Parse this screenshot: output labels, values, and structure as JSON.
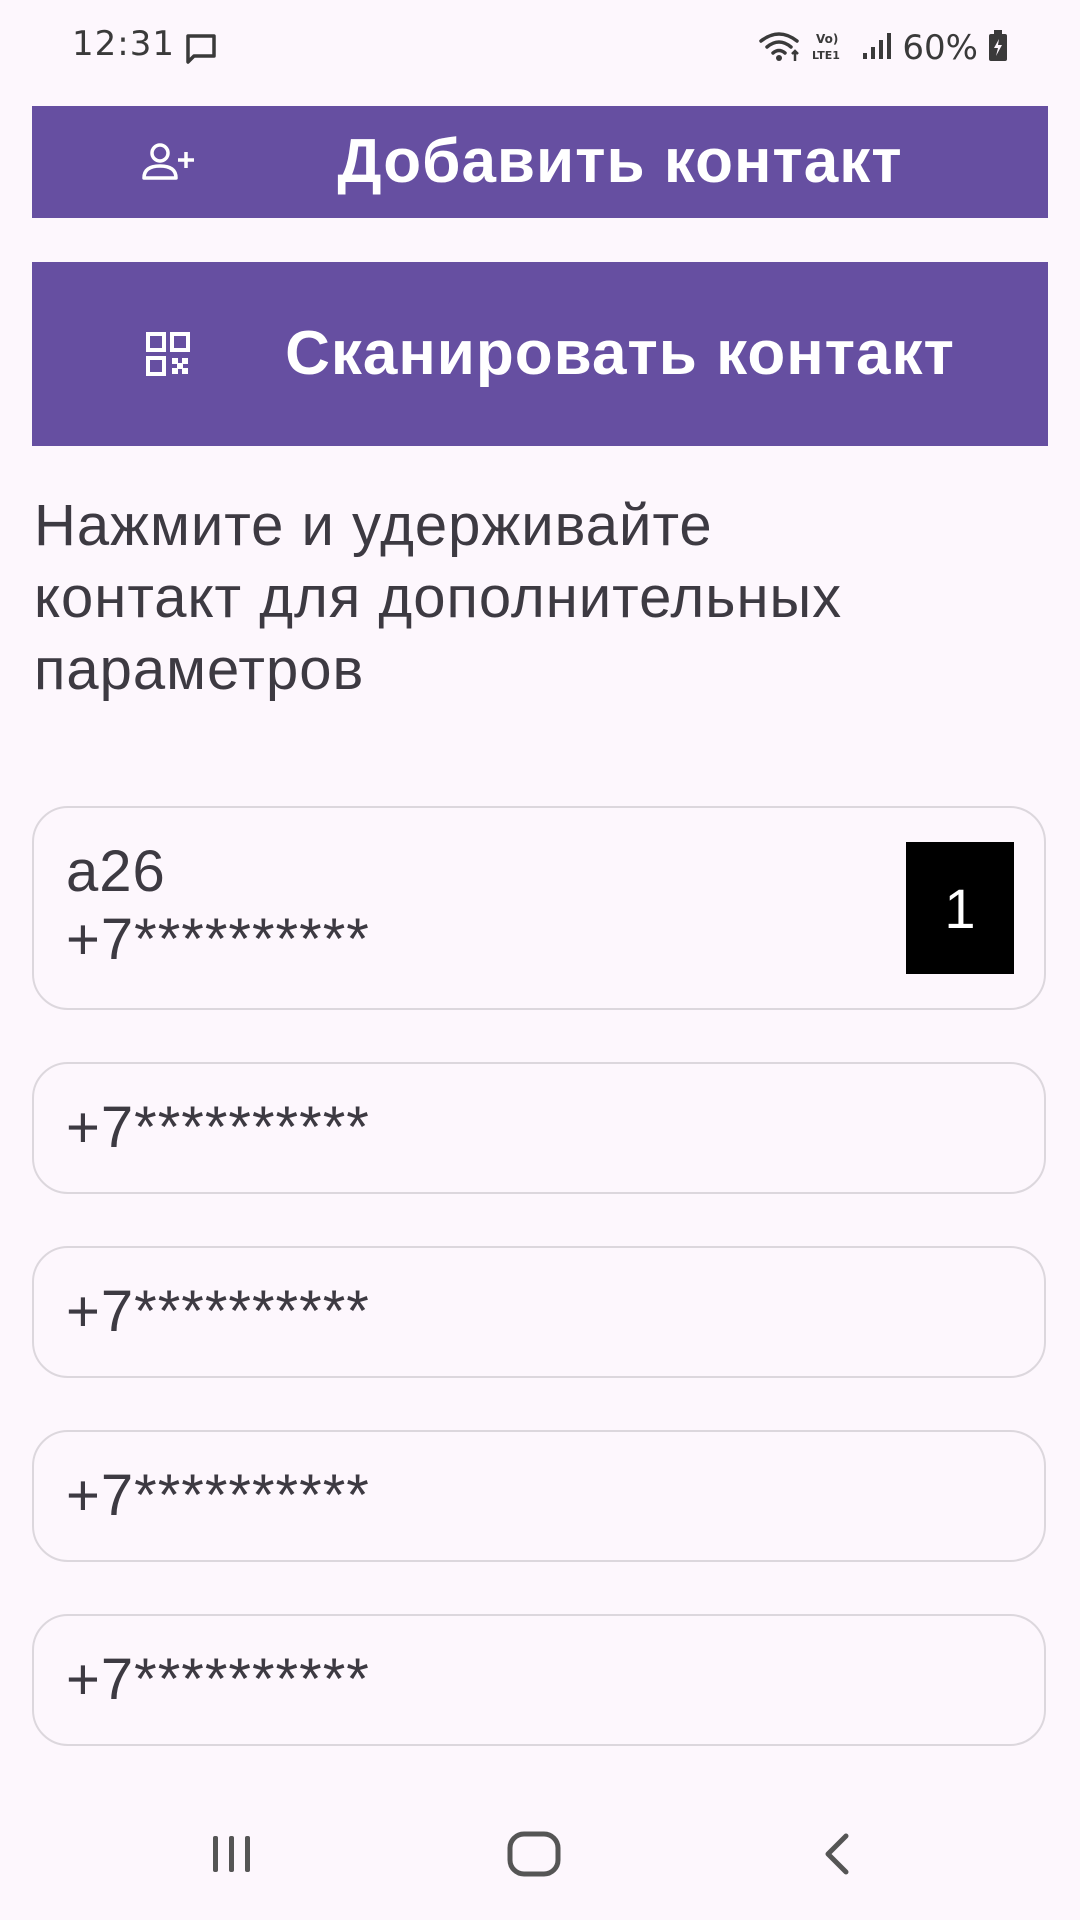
{
  "status_bar": {
    "time": "12:31",
    "battery": "60%"
  },
  "actions": {
    "add_contact_label": "Добавить контакт",
    "scan_contact_label": "Сканировать контакт"
  },
  "hint": "Нажмите и удерживайте контакт для дополнительных параметров",
  "contacts": [
    {
      "name": "a26",
      "phone": "+7**********",
      "badge": "1"
    },
    {
      "phone": "+7**********"
    },
    {
      "phone": "+7**********"
    },
    {
      "phone": "+7**********"
    },
    {
      "phone": "+7**********"
    }
  ],
  "icons": {
    "message": "message-icon",
    "wifi": "wifi-icon",
    "volte": "volte-icon",
    "signal": "signal-icon",
    "battery": "battery-icon",
    "add_person": "add-person-icon",
    "qr": "qr-code-icon",
    "recents": "recents-icon",
    "home": "home-icon",
    "back": "back-icon"
  },
  "colors": {
    "primary": "#664fa1",
    "background": "#fdf7fd",
    "card_border": "#dcd7dd",
    "badge": "#000000"
  }
}
